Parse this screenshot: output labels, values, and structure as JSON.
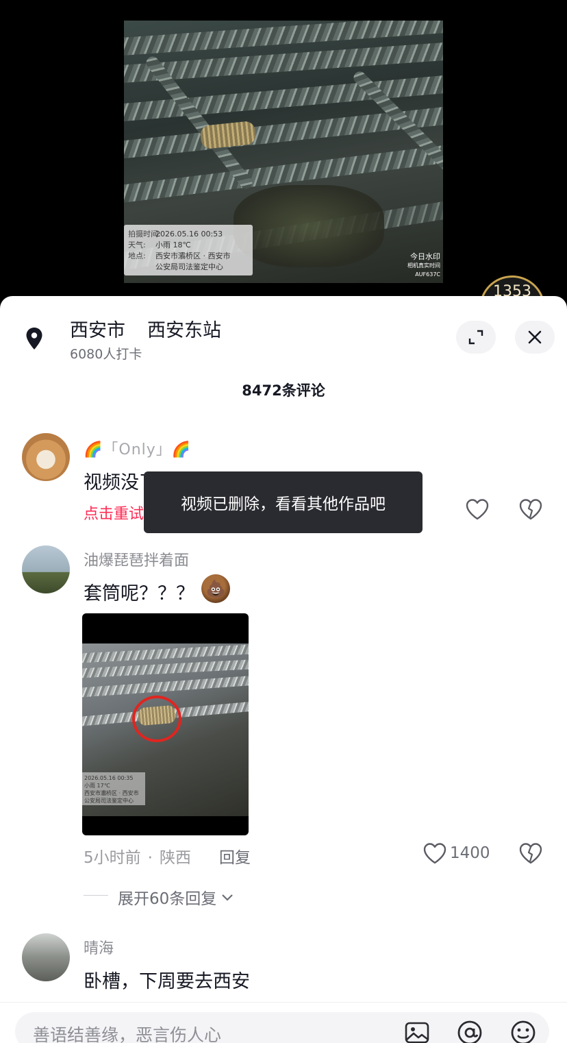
{
  "video": {
    "stamp": {
      "time_label": "拍摄时间:",
      "time_value": "2026.05.16 00:53",
      "weather_label": "天气:",
      "weather_value": "小雨 18℃",
      "place_label": "地点:",
      "place_value": "西安市灞桥区 · 西安市",
      "place_value2": "公安局司法鉴定中心"
    },
    "watermark_title": "今日水印",
    "watermark_sub": "相机真实时间",
    "watermark_code": "AUF637C",
    "counter": "1353"
  },
  "location": {
    "city": "西安市",
    "station": "西安东站",
    "checkins": "6080人打卡"
  },
  "comments_header": "8472条评论",
  "toast": "视频已删除，看看其他作品吧",
  "comments": [
    {
      "username": "🌈「Only」🌈",
      "text": "视频没了",
      "retry": "点击重试"
    },
    {
      "username": "油爆琵琶拌着面",
      "text": "套筒呢？？？",
      "emoji": "💩",
      "attachment_stamp": {
        "line1": "2026.05.16 00:35",
        "line2": "小雨 17℃",
        "line3": "西安市灞桥区 · 西安市",
        "line4": "公安局司法鉴定中心"
      },
      "time": "5小时前",
      "region": "陕西",
      "reply_label": "回复",
      "likes": "1400",
      "expand_replies": "展开60条回复"
    },
    {
      "username": "晴海",
      "text": "卧槽，下周要去西安"
    }
  ],
  "input": {
    "placeholder": "善语结善缘，恶言伤人心"
  },
  "icons": {
    "location": "map-pin-icon",
    "expand": "expand-icon",
    "close": "close-icon",
    "like": "heart-icon",
    "dislike": "broken-heart-icon",
    "chevron": "chevron-down-icon",
    "image": "image-icon",
    "at": "at-icon",
    "emoji": "emoji-icon"
  },
  "colors": {
    "accent": "#fe2c55",
    "toast_bg": "#2a2b30",
    "badge_ring": "#c9a44f"
  }
}
